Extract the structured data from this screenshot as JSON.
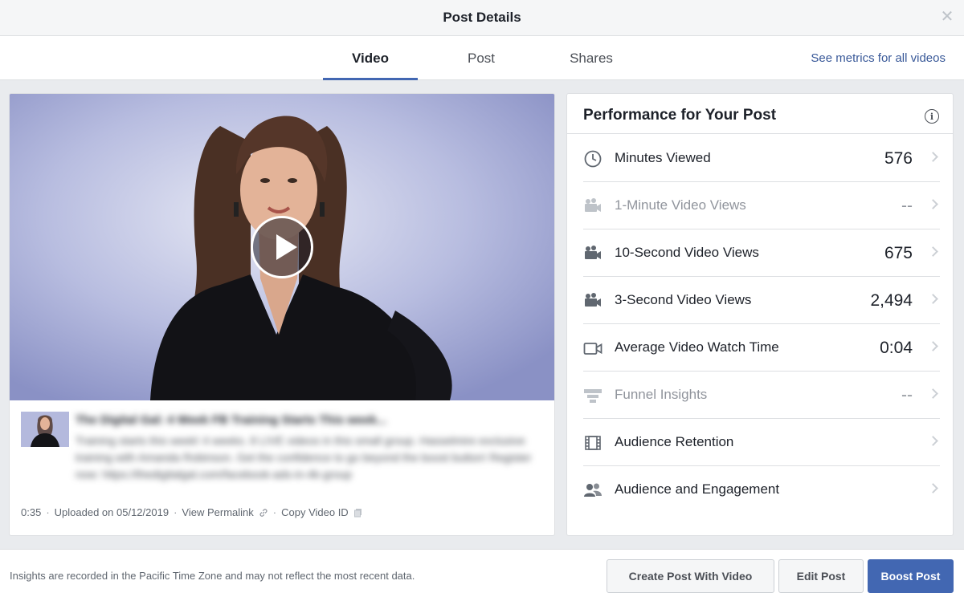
{
  "header": {
    "title": "Post Details",
    "close_glyph": "✕"
  },
  "tabs": [
    {
      "label": "Video",
      "active": true
    },
    {
      "label": "Post",
      "active": false
    },
    {
      "label": "Shares",
      "active": false
    }
  ],
  "see_metrics_link": "See metrics for all videos",
  "video": {
    "post_title": "The Digital Gal: 4 Week FB Training Starts This week...",
    "post_body": "Training starts this week! 4 weeks. 8 LIVE videos in this small group. Hasselmire exclusive training with Amanda Robinson. Get the confidence to go beyond the boost button! Register now: https://thedigitalgal.com/facebook-ads-in-4k-group",
    "duration": "0:35",
    "uploaded": "Uploaded on 05/12/2019",
    "permalink": "View Permalink",
    "copy_id": "Copy Video ID",
    "separator": "·"
  },
  "performance": {
    "title": "Performance for Your Post",
    "info_glyph": "i",
    "metrics": [
      {
        "icon": "clock-icon",
        "label": "Minutes Viewed",
        "value": "576",
        "dim": false
      },
      {
        "icon": "video-camera-icon",
        "label": "1-Minute Video Views",
        "value": "--",
        "dim": true
      },
      {
        "icon": "video-camera-icon",
        "label": "10-Second Video Views",
        "value": "675",
        "dim": false
      },
      {
        "icon": "video-camera-icon",
        "label": "3-Second Video Views",
        "value": "2,494",
        "dim": false
      },
      {
        "icon": "camcorder-icon",
        "label": "Average Video Watch Time",
        "value": "0:04",
        "dim": false
      },
      {
        "icon": "funnel-icon",
        "label": "Funnel Insights",
        "value": "--",
        "dim": true
      },
      {
        "icon": "film-strip-icon",
        "label": "Audience Retention",
        "value": "",
        "dim": false
      },
      {
        "icon": "people-icon",
        "label": "Audience and Engagement",
        "value": "",
        "dim": false
      }
    ]
  },
  "footer": {
    "note": "Insights are recorded in the Pacific Time Zone and may not reflect the most recent data.",
    "create_label": "Create Post With Video",
    "edit_label": "Edit Post",
    "boost_label": "Boost Post"
  },
  "colors": {
    "accent": "#4267b2",
    "link": "#385898",
    "bg": "#e9ebee"
  }
}
